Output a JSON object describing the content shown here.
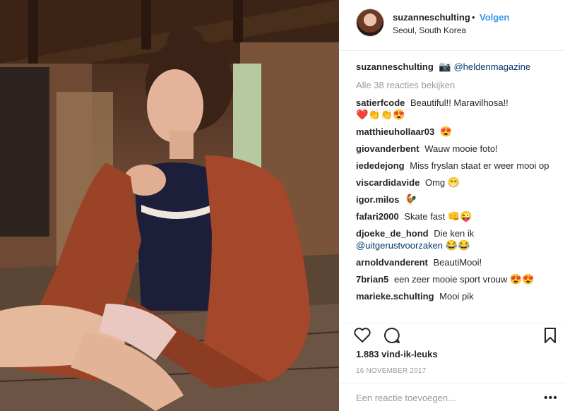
{
  "header": {
    "username": "suzanneschulting",
    "dot": "•",
    "follow_label": "Volgen",
    "location": "Seoul, South Korea"
  },
  "caption": {
    "username": "suzanneschulting",
    "emoji": "📷",
    "mention": "@heldenmagazine"
  },
  "view_all_label": "Alle 38 reacties bekijken",
  "comments": [
    {
      "user": "satierfcode",
      "text": "Beautiful!! Maravilhosa!!",
      "emoji": "❤️👏👏😍"
    },
    {
      "user": "matthieuhollaar03",
      "text": "",
      "emoji": "😍"
    },
    {
      "user": "giovanderbent",
      "text": "Wauw mooie foto!",
      "emoji": ""
    },
    {
      "user": "iededejong",
      "text": "Miss fryslan staat er weer mooi op",
      "emoji": ""
    },
    {
      "user": "viscardidavide",
      "text": "Omg",
      "emoji": "😁"
    },
    {
      "user": "igor.milos",
      "text": "",
      "emoji": "🐓"
    },
    {
      "user": "fafari2000",
      "text": "Skate fast",
      "emoji": "👊😜"
    },
    {
      "user": "djoeke_de_hond",
      "text": "Die ken ik",
      "mention": "@uitgerustvoorzaken",
      "emoji": "😂😂"
    },
    {
      "user": "arnoldvanderent",
      "text": "BeautiMooi!",
      "emoji": ""
    },
    {
      "user": "7brian5",
      "text": "een zeer mooie sport vrouw",
      "emoji": "😍😍"
    },
    {
      "user": "marieke.schulting",
      "text": "Mooi pik",
      "emoji": ""
    }
  ],
  "likes_label": "1.883 vind-ik-leuks",
  "date_label": "16 NOVEMBER 2017",
  "add_comment": {
    "placeholder": "Een reactie toevoegen...",
    "more_label": "•••"
  },
  "icons": {
    "like": "heart-icon",
    "comment": "comment-bubble-icon",
    "save": "bookmark-icon"
  },
  "colors": {
    "accent": "#3897f0",
    "mention": "#003569",
    "muted": "#999999"
  }
}
